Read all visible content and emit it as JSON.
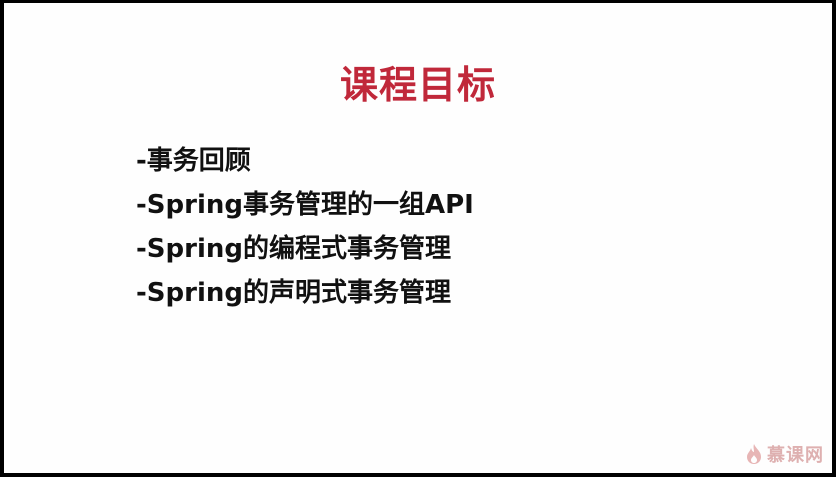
{
  "slide": {
    "title": "课程目标",
    "items": [
      "-事务回顾",
      "-Spring事务管理的一组API",
      "-Spring的编程式事务管理",
      "-Spring的声明式事务管理"
    ]
  },
  "watermark": {
    "text": "慕课网",
    "icon": "flame-logo-icon",
    "color": "#d9a3a3"
  },
  "colors": {
    "title": "#c0283a",
    "text": "#111111",
    "background": "#fefefe",
    "frame": "#000000"
  }
}
